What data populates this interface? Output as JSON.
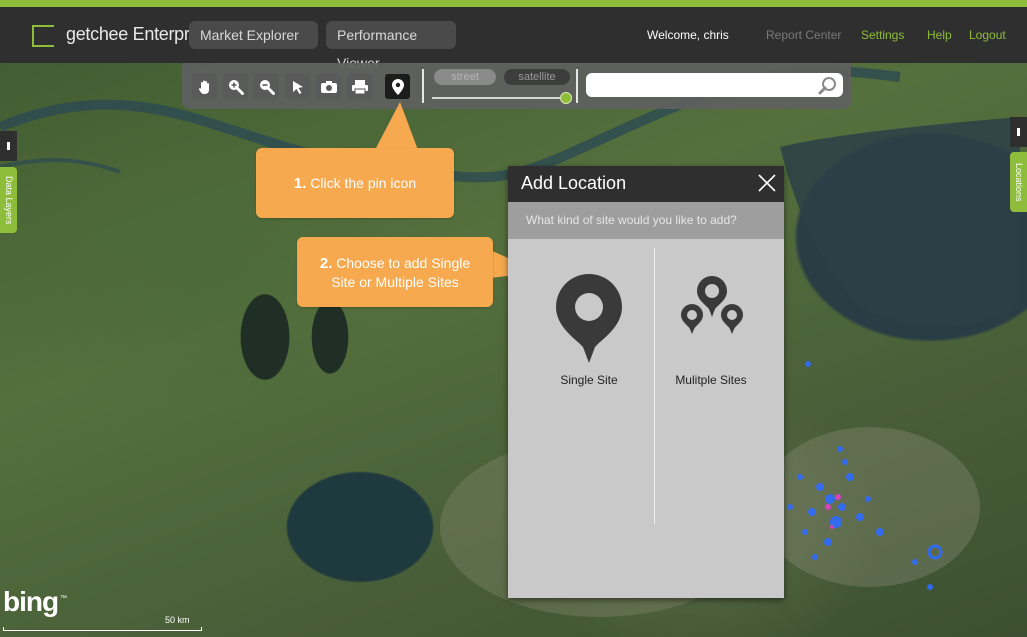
{
  "header": {
    "logo_text": "getchee Enterprise",
    "tabs": [
      {
        "label": "Market Explorer"
      },
      {
        "label": "Performance Viewer"
      }
    ],
    "welcome": "Welcome, chris",
    "links": {
      "report_center": "Report Center",
      "settings": "Settings",
      "help": "Help",
      "logout": "Logout"
    }
  },
  "toolbar": {
    "tools": [
      "pan-hand-icon",
      "zoom-in-icon",
      "zoom-out-icon",
      "select-arrow-icon",
      "camera-icon",
      "printer-icon",
      "pin-icon"
    ],
    "map_types": {
      "street": "street",
      "satellite": "satellite"
    },
    "search": {
      "value": "",
      "placeholder": ""
    }
  },
  "side_tabs": {
    "left": "Data Layers",
    "right": "Locations"
  },
  "callouts": {
    "step1_num": "1.",
    "step1_text": "Click the pin icon",
    "step2_num": "2.",
    "step2_line1": "Choose to add Single",
    "step2_line2": "Site or Multiple Sites"
  },
  "dialog": {
    "title": "Add Location",
    "question": "What kind of site would you like to add?",
    "options": [
      {
        "label": "Single Site",
        "icon": "single-pin-icon"
      },
      {
        "label": "Mulitple Sites",
        "icon": "multiple-pins-icon"
      }
    ]
  },
  "map": {
    "attribution": "bing",
    "trademark": "™",
    "scale_label": "50 km"
  },
  "colors": {
    "accent_green": "#8dbd3a",
    "callout_orange": "#f6a94f",
    "header_bg": "#2f2f2f",
    "marker_blue": "#2f6bff",
    "marker_pink": "#e040c8"
  }
}
